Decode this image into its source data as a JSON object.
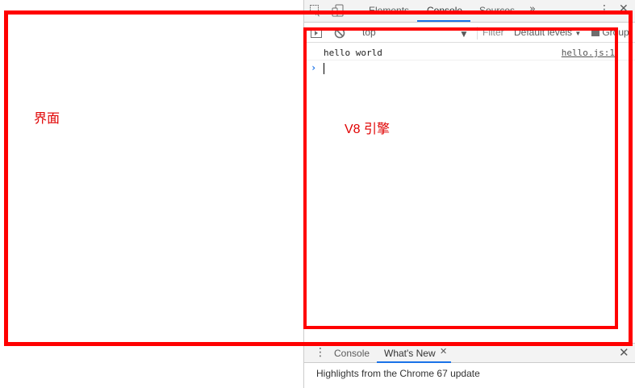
{
  "devtools": {
    "tabs": [
      {
        "label": "Elements"
      },
      {
        "label": "Console"
      },
      {
        "label": "Sources"
      }
    ],
    "more_tabs": "»",
    "toolbar": {
      "context": "top",
      "filter_placeholder": "Filter",
      "levels": "Default levels",
      "group": "Group"
    },
    "console": {
      "messages": [
        {
          "text": "hello world",
          "source": "hello.js:1"
        }
      ],
      "prompt_glyph": "›"
    },
    "drawer": {
      "tabs": [
        {
          "label": "Console"
        },
        {
          "label": "What's New"
        }
      ],
      "highlight_text": "Highlights from the Chrome 67 update"
    }
  },
  "annotations": {
    "ui_label": "界面",
    "v8_label": "V8 引擎",
    "color": "#ff0000"
  },
  "colors": {
    "accent": "#1a73e8",
    "toolbar_bg": "#f3f3f3"
  }
}
